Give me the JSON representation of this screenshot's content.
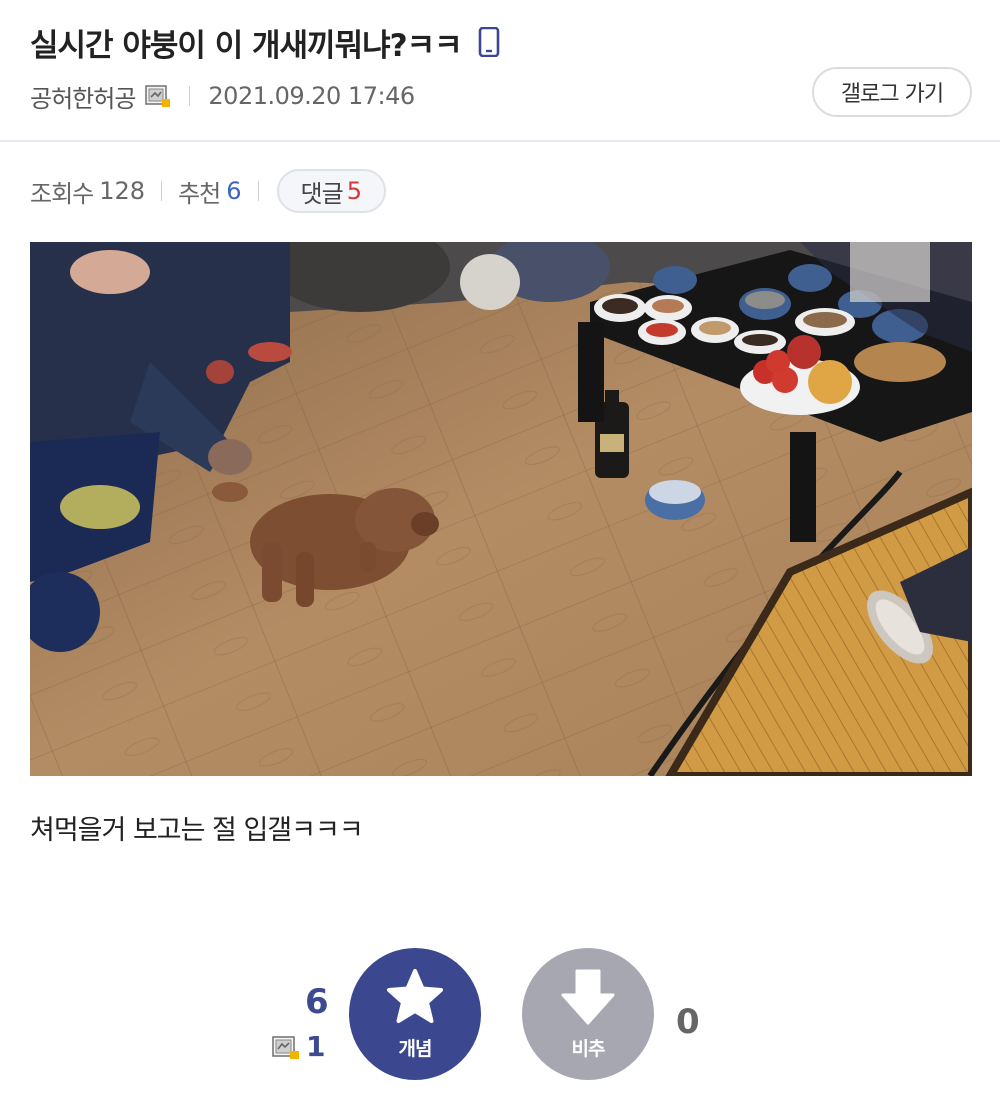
{
  "post": {
    "title": "실시간 야붕이 이 개새끼뭐냐?ㅋㅋ",
    "author": "공허한허공",
    "date": "2021.09.20 17:46",
    "gallog_button": "갤로그 가기",
    "body": "쳐먹을거 보고는 절 입갤ㅋㅋㅋ"
  },
  "stats": {
    "views_label": "조회수",
    "views": "128",
    "recommend_label": "추천",
    "recommend": "6",
    "comments_label": "댓글",
    "comments": "5"
  },
  "vote": {
    "up_count": "6",
    "fixed_count": "1",
    "up_label": "개념",
    "down_label": "비추",
    "down_count": "0"
  },
  "colors": {
    "accent": "#3b4890",
    "recommend_blue": "#3b66c4",
    "comment_red": "#d13a3a",
    "down_gray": "#a6a7b0"
  },
  "icons": {
    "mobile": "mobile-phone-icon",
    "gallog": "gallog-badge-icon",
    "star": "star-icon",
    "down": "down-arrow-icon"
  }
}
